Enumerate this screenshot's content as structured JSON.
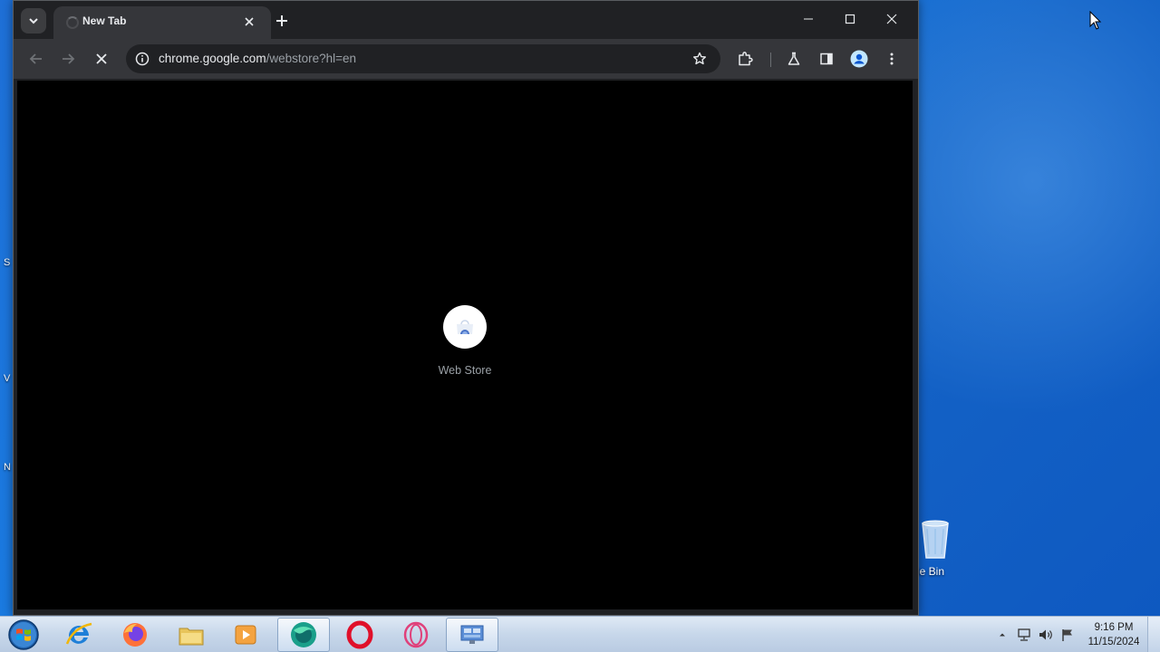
{
  "browser": {
    "tab": {
      "title": "New Tab"
    },
    "address": {
      "host": "chrome.google.com",
      "path": "/webstore?hl=en"
    },
    "splash": {
      "label": "Web Store"
    }
  },
  "desktop": {
    "recycle_bin_label": "le Bin",
    "edge_letters": [
      "S",
      "V",
      "N"
    ]
  },
  "taskbar": {
    "apps": [
      "start",
      "internet-explorer",
      "firefox",
      "file-explorer",
      "media-player",
      "browser-active",
      "opera",
      "opera-gx",
      "network-app"
    ],
    "clock": {
      "time": "9:16 PM",
      "date": "11/15/2024"
    }
  },
  "colors": {
    "desktop_blue": "#1a7ae0",
    "chrome_dark": "#202124",
    "toolbar_dark": "#35363a",
    "viewport": "#000000",
    "opera_red": "#e0102a",
    "opera_gx_pink": "#e0407a"
  }
}
